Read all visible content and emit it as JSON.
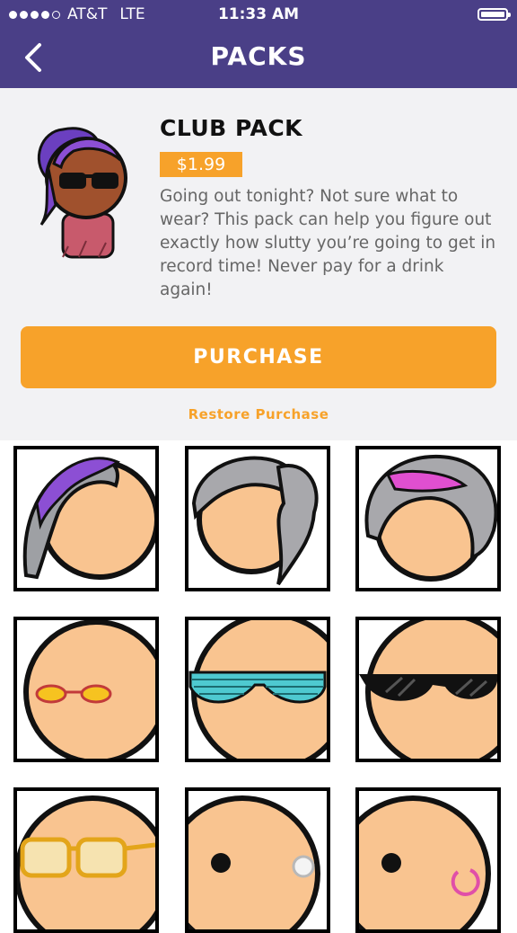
{
  "status": {
    "carrier": "AT&T",
    "network": "LTE",
    "time": "11:33 AM"
  },
  "nav": {
    "title": "PACKS",
    "back_icon": "chevron-left-icon"
  },
  "pack": {
    "name": "CLUB PACK",
    "price": "$1.99",
    "description": "Going out tonight? Not sure what to wear? This pack can help you figure out exactly how slutty you’re going to get in record time! Never pay for a drink again!",
    "purchase_label": "PURCHASE",
    "restore_label": "Restore Purchase"
  },
  "colors": {
    "nav_bg": "#4a3f87",
    "accent": "#f7a22a",
    "skin": "#f9c490"
  },
  "items": [
    {
      "icon": "purple-streak-hair-icon"
    },
    {
      "icon": "gray-ponytail-hair-icon"
    },
    {
      "icon": "gray-pink-bob-hair-icon"
    },
    {
      "icon": "round-yellow-glasses-icon"
    },
    {
      "icon": "shutter-shades-icon"
    },
    {
      "icon": "black-sunglasses-icon"
    },
    {
      "icon": "gold-frame-glasses-icon"
    },
    {
      "icon": "pearl-earring-icon"
    },
    {
      "icon": "pink-hoop-earring-icon"
    }
  ]
}
